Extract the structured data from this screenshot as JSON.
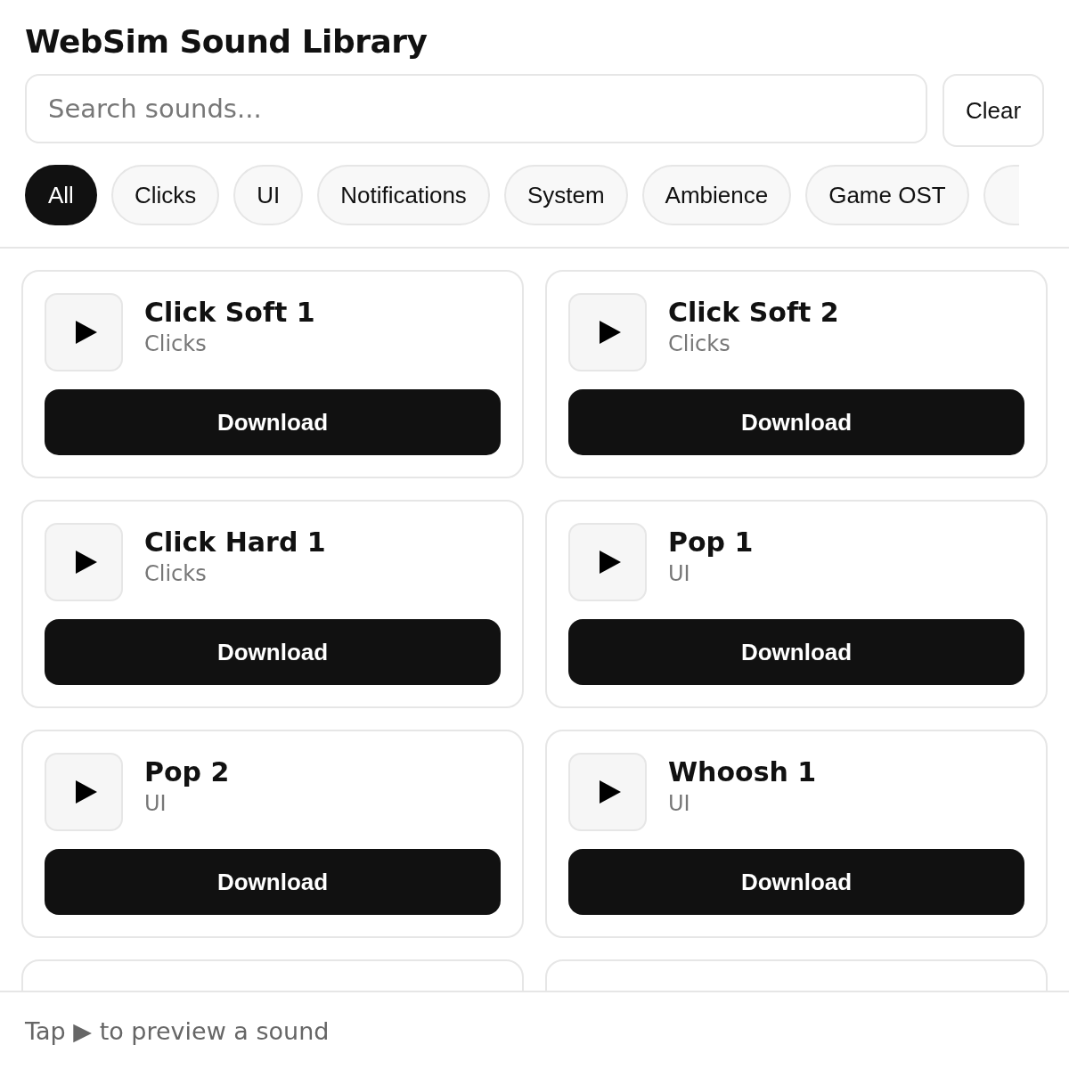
{
  "title": "WebSim Sound Library",
  "search": {
    "placeholder": "Search sounds..."
  },
  "clear_button": "Clear",
  "categories": [
    {
      "label": "All",
      "selected": true
    },
    {
      "label": "Clicks",
      "selected": false
    },
    {
      "label": "UI",
      "selected": false
    },
    {
      "label": "Notifications",
      "selected": false
    },
    {
      "label": "System",
      "selected": false
    },
    {
      "label": "Ambience",
      "selected": false
    },
    {
      "label": "Game OST",
      "selected": false
    }
  ],
  "sounds": [
    {
      "name": "Click Soft 1",
      "category": "Clicks",
      "action": "Download"
    },
    {
      "name": "Click Soft 2",
      "category": "Clicks",
      "action": "Download"
    },
    {
      "name": "Click Hard 1",
      "category": "Clicks",
      "action": "Download"
    },
    {
      "name": "Pop 1",
      "category": "UI",
      "action": "Download"
    },
    {
      "name": "Pop 2",
      "category": "UI",
      "action": "Download"
    },
    {
      "name": "Whoosh 1",
      "category": "UI",
      "action": "Download"
    }
  ],
  "footer": "Tap ▶ to preview a sound"
}
